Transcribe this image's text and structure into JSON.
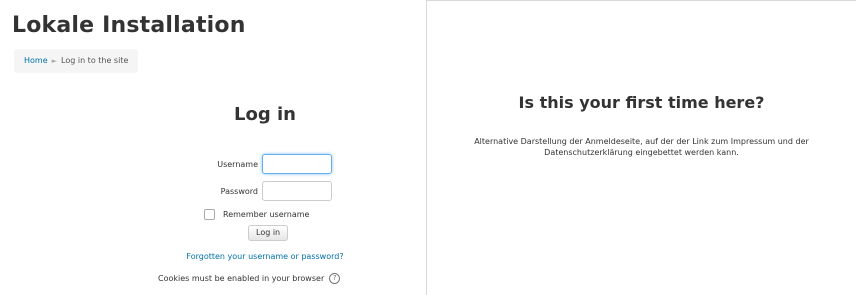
{
  "site": {
    "title": "Lokale Installation"
  },
  "breadcrumb": {
    "home": "Home",
    "separator": "►",
    "current": "Log in to the site"
  },
  "login": {
    "title": "Log in",
    "username_label": "Username",
    "username_value": "",
    "password_label": "Password",
    "password_value": "",
    "remember_label": "Remember username",
    "submit_label": "Log in",
    "forgot_link": "Forgotten your username or password?",
    "cookies_text": "Cookies must be enabled in your browser",
    "help_icon": "?"
  },
  "first_time": {
    "title": "Is this your first time here?",
    "text": "Alternative Darstellung der Anmeldeseite, auf der der Link zum Impressum und der Datenschutzerklärung eingebettet werden kann."
  },
  "colors": {
    "link": "#0070a8",
    "focus": "#66afe9",
    "breadcrumb_bg": "#f5f5f5"
  }
}
